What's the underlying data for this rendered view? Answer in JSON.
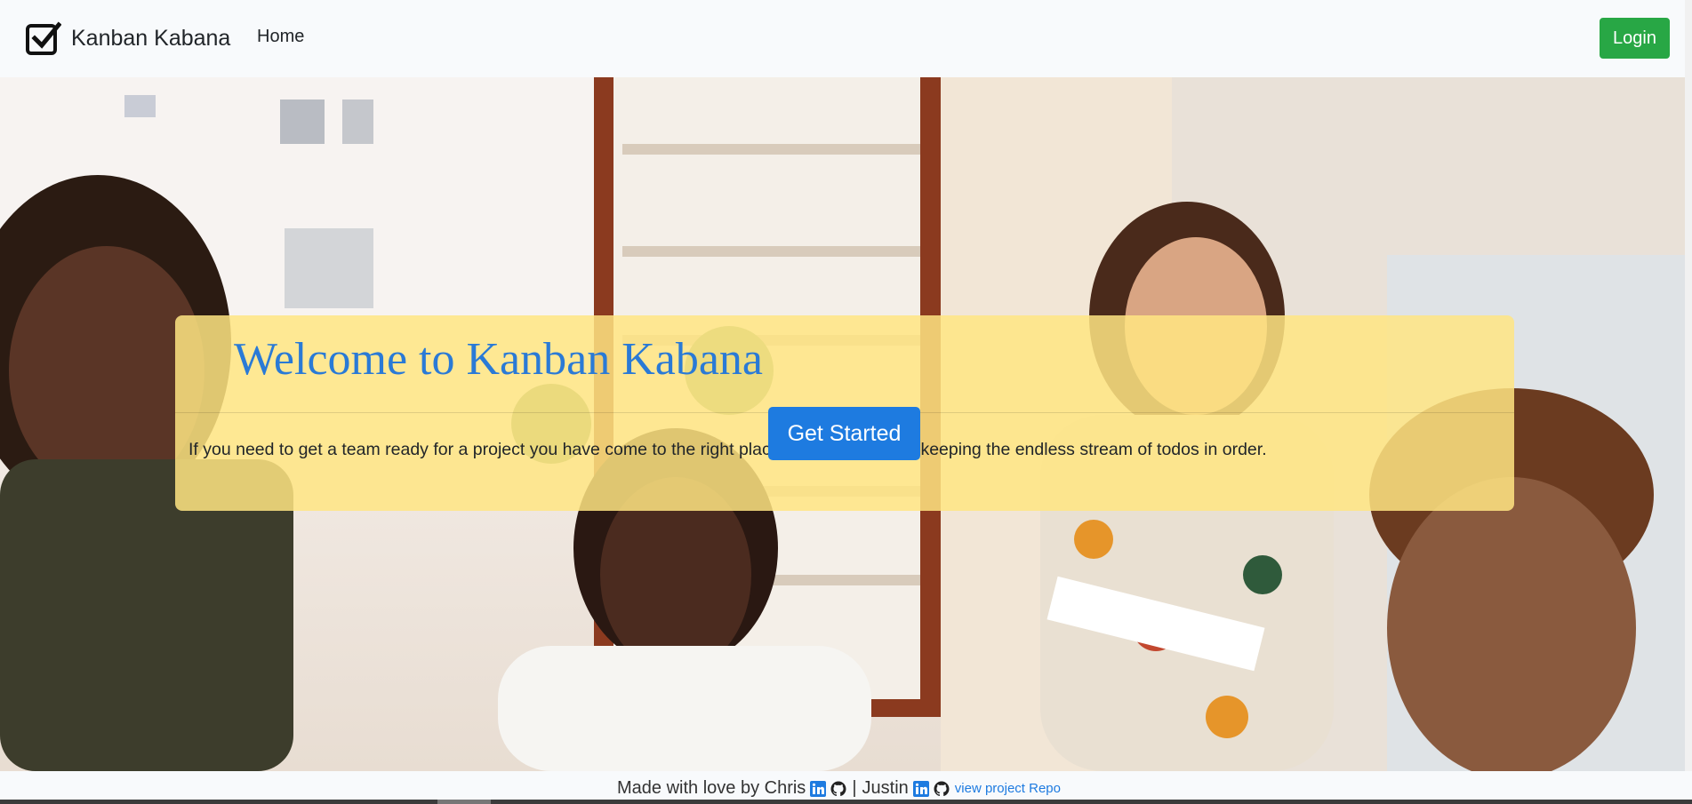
{
  "navbar": {
    "brand": "Kanban Kabana",
    "brand_icon": "checkbox-icon",
    "home_link": "Home",
    "login_button": "Login"
  },
  "hero": {
    "title": "Welcome to Kanban Kabana",
    "description": "If you need to get a team ready for a project you have come to the right place. We are all about keeping the endless stream of todos in order.",
    "cta_button": "Get Started"
  },
  "footer": {
    "made_with": "Made with love by Chris",
    "separator": "|",
    "second_author": "Justin",
    "repo_link": "view project Repo",
    "icons": [
      "linkedin-icon",
      "github-icon"
    ]
  },
  "colors": {
    "accent_blue": "#1e7be0",
    "login_green": "#28a745",
    "jumbotron_yellow": "#ffe582",
    "title_blue": "#2a7ad6"
  }
}
